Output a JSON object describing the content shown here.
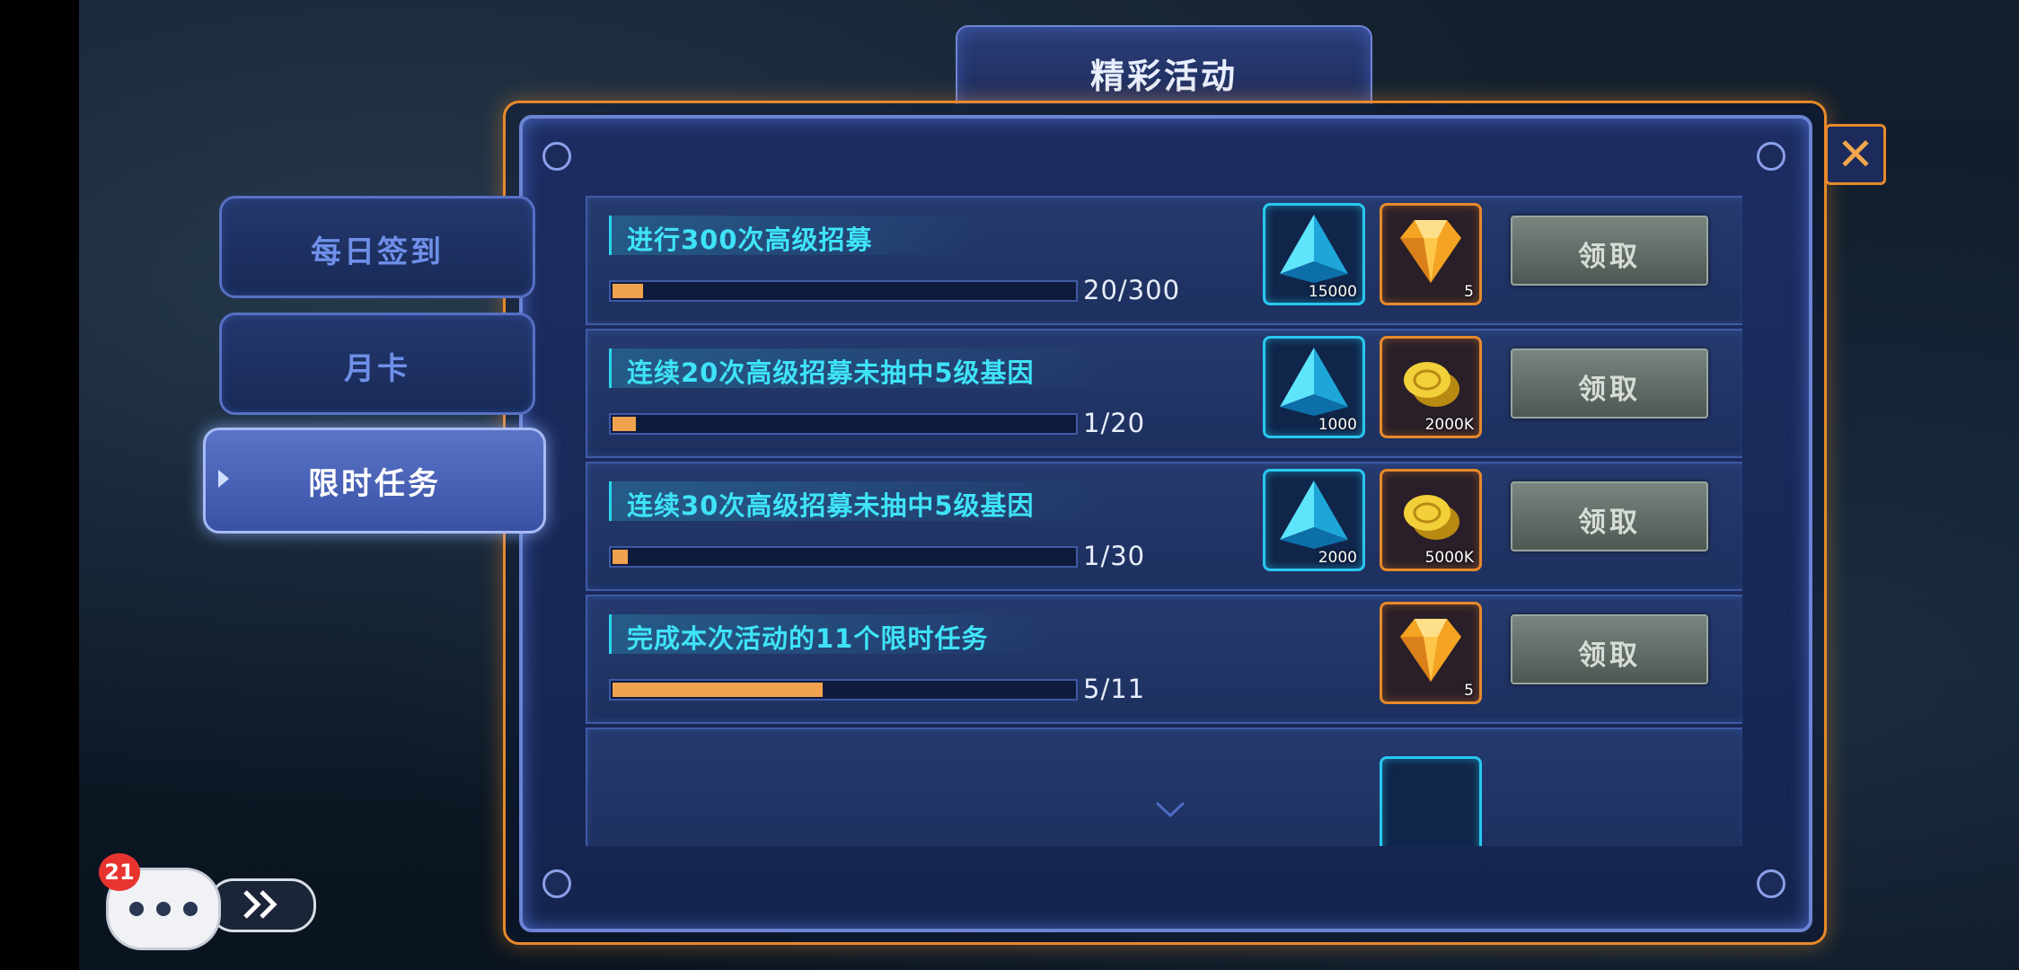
{
  "header": {
    "title": "精彩活动"
  },
  "sidebar": {
    "tabs": [
      {
        "label": "每日签到",
        "active": false
      },
      {
        "label": "月卡",
        "active": false
      },
      {
        "label": "限时任务",
        "active": true
      }
    ]
  },
  "tasks": [
    {
      "title": "进行300次高级招募",
      "progress_text": "20/300",
      "progress": 0.067,
      "rewards": [
        {
          "icon": "blue-crystal-icon",
          "count": "15000"
        },
        {
          "icon": "orange-diamond-icon",
          "count": "5"
        }
      ],
      "button": "领取"
    },
    {
      "title": "连续20次高级招募未抽中5级基因",
      "progress_text": "1/20",
      "progress": 0.05,
      "rewards": [
        {
          "icon": "blue-crystal-icon",
          "count": "1000"
        },
        {
          "icon": "gold-coin-icon",
          "count": "2000K"
        }
      ],
      "button": "领取"
    },
    {
      "title": "连续30次高级招募未抽中5级基因",
      "progress_text": "1/30",
      "progress": 0.033,
      "rewards": [
        {
          "icon": "blue-crystal-icon",
          "count": "2000"
        },
        {
          "icon": "gold-coin-icon",
          "count": "5000K"
        }
      ],
      "button": "领取"
    },
    {
      "title": "完成本次活动的11个限时任务",
      "progress_text": "5/11",
      "progress": 0.455,
      "rewards": [
        {
          "icon": "orange-diamond-icon",
          "count": "5"
        }
      ],
      "button": "领取"
    }
  ],
  "chat": {
    "unread_badge": "21"
  },
  "colors": {
    "accent_orange": "#e8892a",
    "title_cyan": "#3fe3f7",
    "progress_orange": "#f0a24e"
  }
}
